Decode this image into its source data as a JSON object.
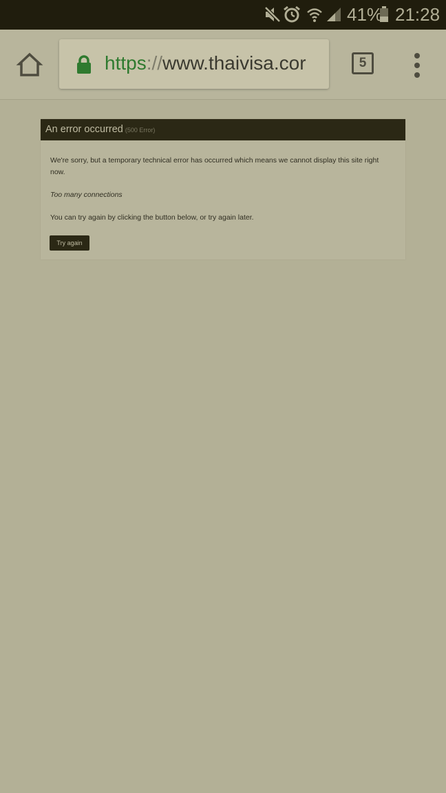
{
  "status_bar": {
    "icons": [
      "mute-icon",
      "alarm-icon",
      "wifi-icon",
      "signal-icon",
      "battery-icon"
    ],
    "battery_percent": "41%",
    "battery_level": 0.41,
    "time": "21:28"
  },
  "toolbar": {
    "home_icon": "home-icon",
    "lock_icon": "lock-icon",
    "url_scheme": "https",
    "url_separator": "://",
    "url_host": "www.thaivisa.cor",
    "tab_count": "5",
    "menu_icon": "more-vert-icon"
  },
  "error": {
    "title": "An error occurred",
    "code": "(500 Error)",
    "message": "We're sorry, but a temporary technical error has occurred which means we cannot display this site right now.",
    "detail": "Too many connections",
    "hint": "You can try again by clicking the button below, or try again later.",
    "button_label": "Try again"
  },
  "colors": {
    "page_background": "#b3b096",
    "status_bar": "#201d0d",
    "header_bar": "#2b2815",
    "secure_green": "#2f7a2f"
  }
}
